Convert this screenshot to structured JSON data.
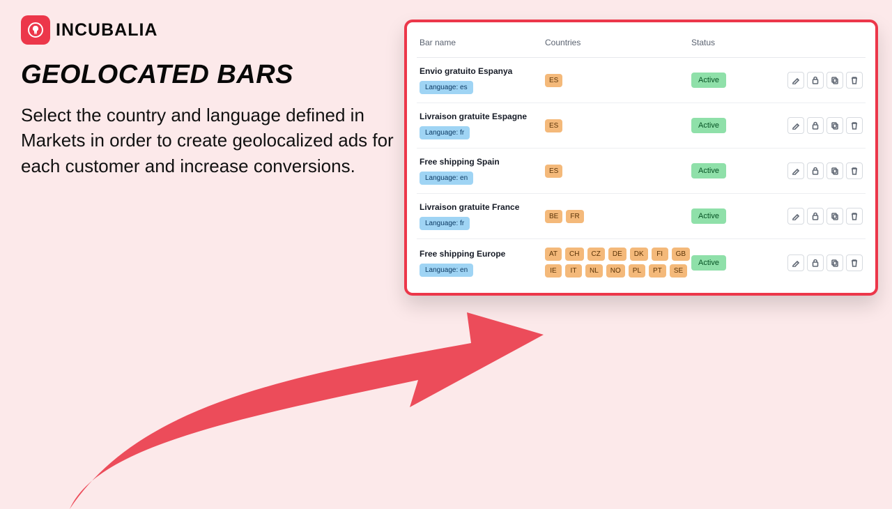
{
  "brand": {
    "name": "INCUBALIA"
  },
  "promo": {
    "headline": "GEOLOCATED BARS",
    "description": "Select the country and language defined in Markets in order to create geolocalized ads for each customer and increase conversions."
  },
  "table": {
    "headers": {
      "name": "Bar name",
      "countries": "Countries",
      "status": "Status"
    },
    "language_prefix": "Language: ",
    "rows": [
      {
        "name": "Envio gratuito Espanya",
        "lang": "es",
        "countries": [
          "ES"
        ],
        "status": "Active"
      },
      {
        "name": "Livraison gratuite Espagne",
        "lang": "fr",
        "countries": [
          "ES"
        ],
        "status": "Active"
      },
      {
        "name": "Free shipping Spain",
        "lang": "en",
        "countries": [
          "ES"
        ],
        "status": "Active"
      },
      {
        "name": "Livraison gratuite France",
        "lang": "fr",
        "countries": [
          "BE",
          "FR"
        ],
        "status": "Active"
      },
      {
        "name": "Free shipping Europe",
        "lang": "en",
        "countries": [
          "AT",
          "CH",
          "CZ",
          "DE",
          "DK",
          "FI",
          "GB",
          "IE",
          "IT",
          "NL",
          "NO",
          "PL",
          "PT",
          "SE"
        ],
        "status": "Active"
      }
    ]
  },
  "actions": {
    "edit": "edit",
    "lock": "lock",
    "copy": "copy",
    "delete": "delete"
  }
}
